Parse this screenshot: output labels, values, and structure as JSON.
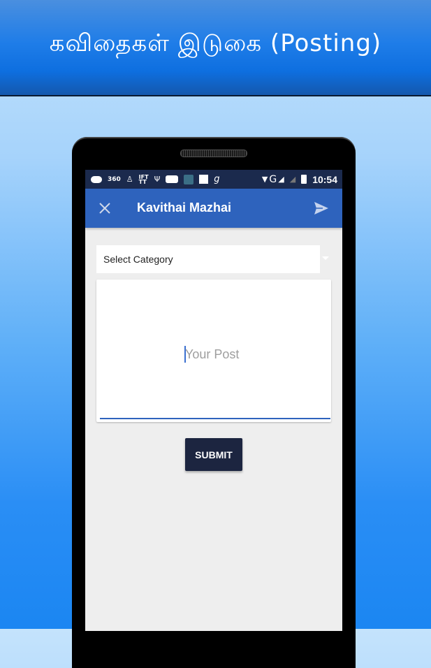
{
  "banner": {
    "title": "கவிதைகள் இடுகை (Posting)"
  },
  "statusbar": {
    "icons": [
      "message-icon",
      "360-icon",
      "robot-icon",
      "ifttt-icon",
      "usb-icon",
      "chat-icon",
      "app-icon",
      "square-icon",
      "g-icon",
      "wifi-icon",
      "signal-icon",
      "signal-empty-icon",
      "battery-charging-icon"
    ],
    "label_360": "360",
    "label_ifttt": "IFT\nTT",
    "label_g": "g",
    "network_label": "G",
    "time": "10:54"
  },
  "appbar": {
    "title": "Kavithai Mazhai",
    "close_icon": "close-icon",
    "send_icon": "send-icon"
  },
  "form": {
    "category_select": {
      "selected": "Select Category"
    },
    "post_input": {
      "value": "",
      "placeholder": "Your Post"
    },
    "submit_label": "SUBMIT"
  },
  "colors": {
    "appbar": "#2e63bd",
    "statusbar": "#1b2a4d",
    "submit": "#1c2540",
    "screen_bg": "#eeeeee"
  }
}
